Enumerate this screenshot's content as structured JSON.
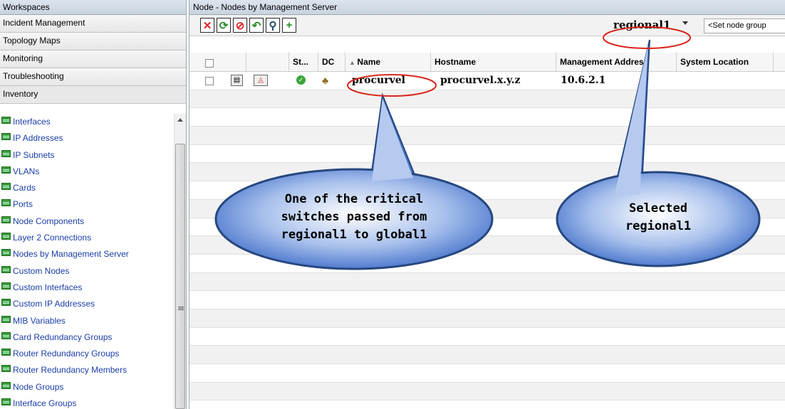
{
  "workspaces": {
    "title": "Workspaces",
    "items": [
      {
        "label": "Incident Management"
      },
      {
        "label": "Topology Maps"
      },
      {
        "label": "Monitoring"
      },
      {
        "label": "Troubleshooting"
      },
      {
        "label": "Inventory"
      }
    ],
    "inventory_items": [
      "Interfaces",
      "IP Addresses",
      "IP Subnets",
      "VLANs",
      "Cards",
      "Ports",
      "Node Components",
      "Layer 2 Connections",
      "Nodes by Management Server",
      "Custom Nodes",
      "Custom Interfaces",
      "Custom IP Addresses",
      "MIB Variables",
      "Card Redundancy Groups",
      "Router Redundancy Groups",
      "Router Redundancy Members",
      "Node Groups",
      "Interface Groups"
    ]
  },
  "view": {
    "title": "Node - Nodes by Management Server",
    "toolbar": {
      "buttons": [
        "delete-icon",
        "refresh-icon",
        "stop-icon",
        "restore-icon",
        "find-icon",
        "add-icon"
      ],
      "server_selected": "regional1",
      "group_select": "<Set node group"
    },
    "columns": [
      "St...",
      "DC",
      "Name",
      "Hostname",
      "Management Address",
      "System Location"
    ],
    "rows": [
      {
        "status": "normal",
        "name": "procurvel",
        "hostname": "procurvel.x.y.z",
        "mgmt_address": "10.6.2.1",
        "system_location": ""
      }
    ]
  },
  "callouts": {
    "left": "One of the critical switches passed from regional1 to global1",
    "left_lines": [
      "One of the critical",
      "switches passed from",
      "regional1 to global1"
    ],
    "right_lines": [
      "Selected",
      "regional1"
    ]
  },
  "colors": {
    "callout_fill": "#5a86d4",
    "highlight_ring": "#d9271c"
  }
}
